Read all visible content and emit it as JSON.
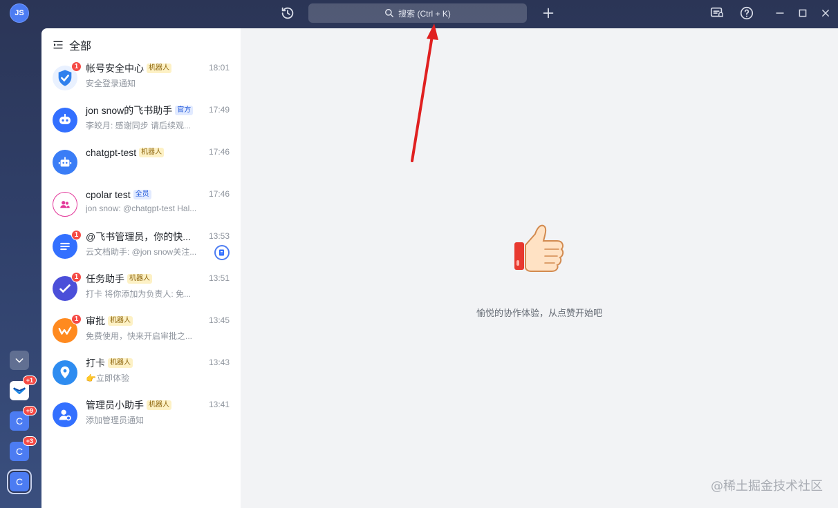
{
  "topbar": {
    "avatar_initials": "JS",
    "search_placeholder": "搜索 (Ctrl + K)"
  },
  "rail": {
    "apps": [
      {
        "label": "C",
        "badge": "+9"
      },
      {
        "label": "C",
        "badge": "+3"
      },
      {
        "label": "C",
        "badge": ""
      }
    ],
    "top_app_badge": "+1"
  },
  "panel": {
    "title": "全部"
  },
  "chats": [
    {
      "name": "帐号安全中心",
      "tag": "机器人",
      "time": "18:01",
      "preview": "安全登录通知",
      "unread": "1"
    },
    {
      "name": "jon snow的飞书助手",
      "tag": "官方",
      "time": "17:49",
      "preview": "李皎月: 感谢同步 请后续观...",
      "unread": ""
    },
    {
      "name": "chatgpt-test",
      "tag": "机器人",
      "time": "17:46",
      "preview": "",
      "unread": ""
    },
    {
      "name": "cpolar test",
      "tag": "全员",
      "time": "17:46",
      "preview": "jon snow: @chatgpt-test Hal...",
      "unread": ""
    },
    {
      "name": "@飞书管理员，你的快...",
      "tag": "",
      "time": "13:53",
      "preview": "云文档助手: @jon snow关注...",
      "unread": "1"
    },
    {
      "name": "任务助手",
      "tag": "机器人",
      "time": "13:51",
      "preview": "打卡 将你添加为负责人: 免...",
      "unread": "1"
    },
    {
      "name": "审批",
      "tag": "机器人",
      "time": "13:45",
      "preview": "免费使用，快来开启审批之...",
      "unread": "1"
    },
    {
      "name": "打卡",
      "tag": "机器人",
      "time": "13:43",
      "preview": "立即体验",
      "unread": ""
    },
    {
      "name": "管理员小助手",
      "tag": "机器人",
      "time": "13:41",
      "preview": "添加管理员通知",
      "unread": ""
    }
  ],
  "main": {
    "empty_text": "愉悦的协作体验，从点赞开始吧",
    "watermark": "@稀土掘金技术社区"
  },
  "colors": {
    "accent": "#4c7cf2",
    "badge": "#f54a45",
    "annotation_arrow": "#e02020"
  }
}
